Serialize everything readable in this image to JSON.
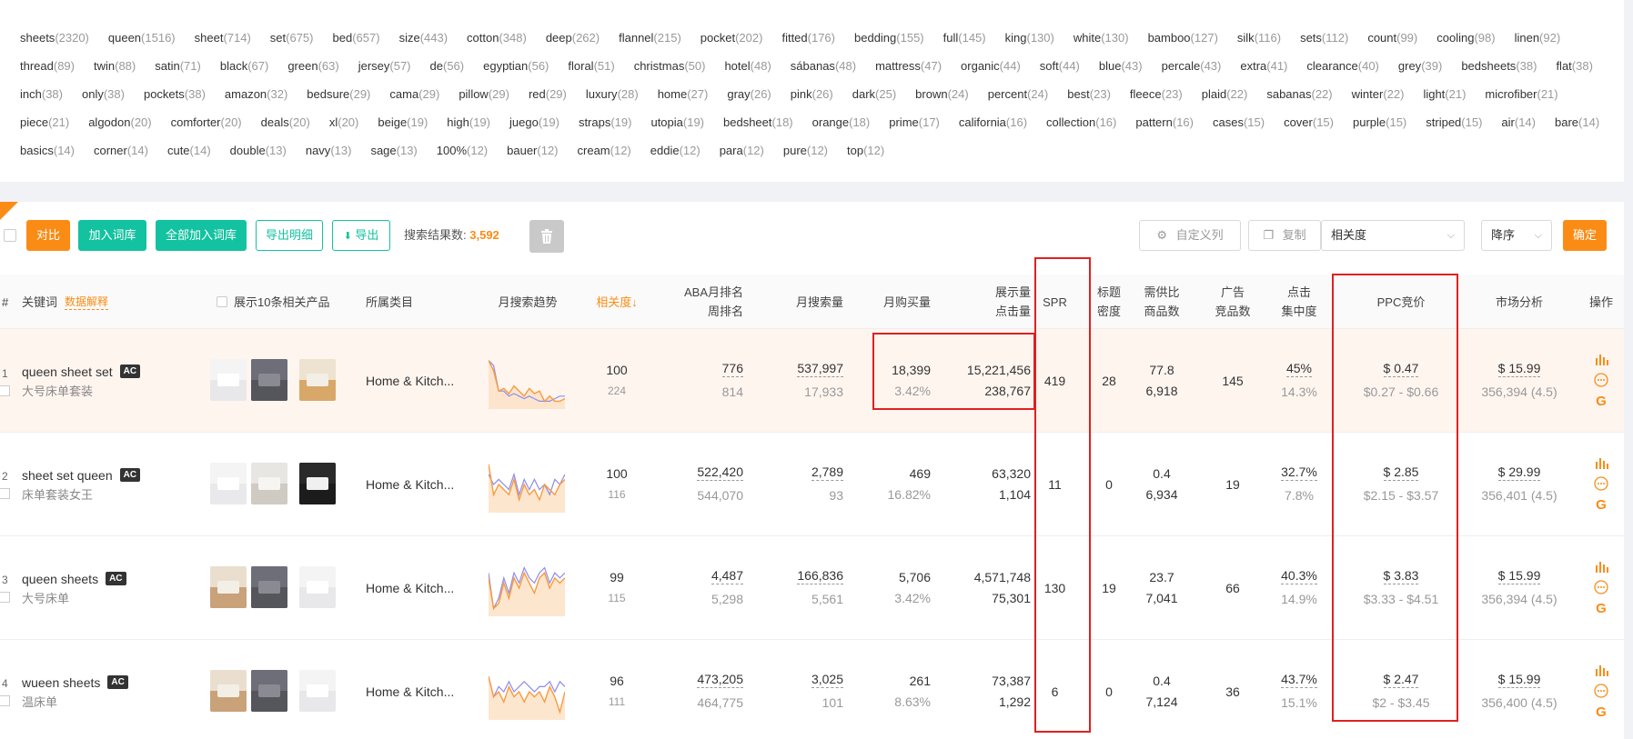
{
  "tags": [
    {
      "word": "sheets",
      "count": "(2320)"
    },
    {
      "word": "queen",
      "count": "(1516)"
    },
    {
      "word": "sheet",
      "count": "(714)"
    },
    {
      "word": "set",
      "count": "(675)"
    },
    {
      "word": "bed",
      "count": "(657)"
    },
    {
      "word": "size",
      "count": "(443)"
    },
    {
      "word": "cotton",
      "count": "(348)"
    },
    {
      "word": "deep",
      "count": "(262)"
    },
    {
      "word": "flannel",
      "count": "(215)"
    },
    {
      "word": "pocket",
      "count": "(202)"
    },
    {
      "word": "fitted",
      "count": "(176)"
    },
    {
      "word": "bedding",
      "count": "(155)"
    },
    {
      "word": "full",
      "count": "(145)"
    },
    {
      "word": "king",
      "count": "(130)"
    },
    {
      "word": "white",
      "count": "(130)"
    },
    {
      "word": "bamboo",
      "count": "(127)"
    },
    {
      "word": "silk",
      "count": "(116)"
    },
    {
      "word": "sets",
      "count": "(112)"
    },
    {
      "word": "count",
      "count": "(99)"
    },
    {
      "word": "cooling",
      "count": "(98)"
    },
    {
      "word": "linen",
      "count": "(92)"
    },
    {
      "word": "thread",
      "count": "(89)"
    },
    {
      "word": "twin",
      "count": "(88)"
    },
    {
      "word": "satin",
      "count": "(71)"
    },
    {
      "word": "black",
      "count": "(67)"
    },
    {
      "word": "green",
      "count": "(63)"
    },
    {
      "word": "jersey",
      "count": "(57)"
    },
    {
      "word": "de",
      "count": "(56)"
    },
    {
      "word": "egyptian",
      "count": "(56)"
    },
    {
      "word": "floral",
      "count": "(51)"
    },
    {
      "word": "christmas",
      "count": "(50)"
    },
    {
      "word": "hotel",
      "count": "(48)"
    },
    {
      "word": "sábanas",
      "count": "(48)"
    },
    {
      "word": "mattress",
      "count": "(47)"
    },
    {
      "word": "organic",
      "count": "(44)"
    },
    {
      "word": "soft",
      "count": "(44)"
    },
    {
      "word": "blue",
      "count": "(43)"
    },
    {
      "word": "percale",
      "count": "(43)"
    },
    {
      "word": "extra",
      "count": "(41)"
    },
    {
      "word": "clearance",
      "count": "(40)"
    },
    {
      "word": "grey",
      "count": "(39)"
    },
    {
      "word": "bedsheets",
      "count": "(38)"
    },
    {
      "word": "flat",
      "count": "(38)"
    },
    {
      "word": "inch",
      "count": "(38)"
    },
    {
      "word": "only",
      "count": "(38)"
    },
    {
      "word": "pockets",
      "count": "(38)"
    },
    {
      "word": "amazon",
      "count": "(32)"
    },
    {
      "word": "bedsure",
      "count": "(29)"
    },
    {
      "word": "cama",
      "count": "(29)"
    },
    {
      "word": "pillow",
      "count": "(29)"
    },
    {
      "word": "red",
      "count": "(29)"
    },
    {
      "word": "luxury",
      "count": "(28)"
    },
    {
      "word": "home",
      "count": "(27)"
    },
    {
      "word": "gray",
      "count": "(26)"
    },
    {
      "word": "pink",
      "count": "(26)"
    },
    {
      "word": "dark",
      "count": "(25)"
    },
    {
      "word": "brown",
      "count": "(24)"
    },
    {
      "word": "percent",
      "count": "(24)"
    },
    {
      "word": "best",
      "count": "(23)"
    },
    {
      "word": "fleece",
      "count": "(23)"
    },
    {
      "word": "plaid",
      "count": "(22)"
    },
    {
      "word": "sabanas",
      "count": "(22)"
    },
    {
      "word": "winter",
      "count": "(22)"
    },
    {
      "word": "light",
      "count": "(21)"
    },
    {
      "word": "microfiber",
      "count": "(21)"
    },
    {
      "word": "piece",
      "count": "(21)"
    },
    {
      "word": "algodon",
      "count": "(20)"
    },
    {
      "word": "comforter",
      "count": "(20)"
    },
    {
      "word": "deals",
      "count": "(20)"
    },
    {
      "word": "xl",
      "count": "(20)"
    },
    {
      "word": "beige",
      "count": "(19)"
    },
    {
      "word": "high",
      "count": "(19)"
    },
    {
      "word": "juego",
      "count": "(19)"
    },
    {
      "word": "straps",
      "count": "(19)"
    },
    {
      "word": "utopia",
      "count": "(19)"
    },
    {
      "word": "bedsheet",
      "count": "(18)"
    },
    {
      "word": "orange",
      "count": "(18)"
    },
    {
      "word": "prime",
      "count": "(17)"
    },
    {
      "word": "california",
      "count": "(16)"
    },
    {
      "word": "collection",
      "count": "(16)"
    },
    {
      "word": "pattern",
      "count": "(16)"
    },
    {
      "word": "cases",
      "count": "(15)"
    },
    {
      "word": "cover",
      "count": "(15)"
    },
    {
      "word": "purple",
      "count": "(15)"
    },
    {
      "word": "striped",
      "count": "(15)"
    },
    {
      "word": "air",
      "count": "(14)"
    },
    {
      "word": "bare",
      "count": "(14)"
    },
    {
      "word": "basics",
      "count": "(14)"
    },
    {
      "word": "corner",
      "count": "(14)"
    },
    {
      "word": "cute",
      "count": "(14)"
    },
    {
      "word": "double",
      "count": "(13)"
    },
    {
      "word": "navy",
      "count": "(13)"
    },
    {
      "word": "sage",
      "count": "(13)"
    },
    {
      "word": "100%",
      "count": "(12)"
    },
    {
      "word": "bauer",
      "count": "(12)"
    },
    {
      "word": "cream",
      "count": "(12)"
    },
    {
      "word": "eddie",
      "count": "(12)"
    },
    {
      "word": "para",
      "count": "(12)"
    },
    {
      "word": "pure",
      "count": "(12)"
    },
    {
      "word": "top",
      "count": "(12)"
    }
  ],
  "toolbar": {
    "compare": "对比",
    "add_to_lib": "加入词库",
    "add_all_to_lib": "全部加入词库",
    "export_detail": "导出明细",
    "export": "导出",
    "result_label": "搜索结果数:",
    "result_count": "3,592",
    "custom_columns": "自定义列",
    "copy": "复制",
    "sort_field": "相关度",
    "sort_order": "降序",
    "confirm": "确定"
  },
  "headers": {
    "num": "#",
    "keyword": "关键词",
    "data_explain": "数据解释",
    "show_products": "展示10条相关产品",
    "category": "所属类目",
    "trend": "月搜索趋势",
    "relevance": "相关度↓",
    "aba_rank_1": "ABA月排名",
    "aba_rank_2": "周排名",
    "monthly_search": "月搜索量",
    "monthly_purchase": "月购买量",
    "impressions_1": "展示量",
    "impressions_2": "点击量",
    "spr": "SPR",
    "title_density_1": "标题",
    "title_density_2": "密度",
    "supply_1": "需供比",
    "supply_2": "商品数",
    "ad_1": "广告",
    "ad_2": "竞品数",
    "click_1": "点击",
    "click_2": "集中度",
    "ppc": "PPC竞价",
    "market": "市场分析",
    "ops": "操作"
  },
  "rows": [
    {
      "num": "1",
      "keyword": "queen sheet set",
      "cn": "大号床单套装",
      "ac": "AC",
      "category": "Home & Kitch...",
      "rel": "100",
      "rel_sub": "224",
      "aba": "776",
      "aba_week": "814",
      "search": "537,997",
      "search_sub": "17,933",
      "purchase": "18,399",
      "purchase_rate": "3.42%",
      "impressions": "15,221,456",
      "clicks": "238,767",
      "spr": "419",
      "title_density": "28",
      "supply_ratio": "77.8",
      "products": "6,918",
      "ad_count": "145",
      "click_conc": "45%",
      "click_conc_sub": "14.3%",
      "ppc": "$ 0.47",
      "ppc_range": "$0.27 - $0.66",
      "market_price": "$ 15.99",
      "market_sub": "356,394 (4.5)"
    },
    {
      "num": "2",
      "keyword": "sheet set queen",
      "cn": "床单套装女王",
      "ac": "AC",
      "category": "Home & Kitch...",
      "rel": "100",
      "rel_sub": "116",
      "aba": "522,420",
      "aba_week": "544,070",
      "search": "2,789",
      "search_sub": "93",
      "purchase": "469",
      "purchase_rate": "16.82%",
      "impressions": "63,320",
      "clicks": "1,104",
      "spr": "11",
      "title_density": "0",
      "supply_ratio": "0.4",
      "products": "6,934",
      "ad_count": "19",
      "click_conc": "32.7%",
      "click_conc_sub": "7.8%",
      "ppc": "$ 2.85",
      "ppc_range": "$2.15 - $3.57",
      "market_price": "$ 29.99",
      "market_sub": "356,401 (4.5)"
    },
    {
      "num": "3",
      "keyword": "queen sheets",
      "cn": "大号床单",
      "ac": "AC",
      "category": "Home & Kitch...",
      "rel": "99",
      "rel_sub": "115",
      "aba": "4,487",
      "aba_week": "5,298",
      "search": "166,836",
      "search_sub": "5,561",
      "purchase": "5,706",
      "purchase_rate": "3.42%",
      "impressions": "4,571,748",
      "clicks": "75,301",
      "spr": "130",
      "title_density": "19",
      "supply_ratio": "23.7",
      "products": "7,041",
      "ad_count": "66",
      "click_conc": "40.3%",
      "click_conc_sub": "14.9%",
      "ppc": "$ 3.83",
      "ppc_range": "$3.33 - $4.51",
      "market_price": "$ 15.99",
      "market_sub": "356,394 (4.5)"
    },
    {
      "num": "4",
      "keyword": "wueen sheets",
      "cn": "温床单",
      "ac": "AC",
      "category": "Home & Kitch...",
      "rel": "96",
      "rel_sub": "111",
      "aba": "473,205",
      "aba_week": "464,775",
      "search": "3,025",
      "search_sub": "101",
      "purchase": "261",
      "purchase_rate": "8.63%",
      "impressions": "73,387",
      "clicks": "1,292",
      "spr": "6",
      "title_density": "0",
      "supply_ratio": "0.4",
      "products": "7,124",
      "ad_count": "36",
      "click_conc": "43.7%",
      "click_conc_sub": "15.1%",
      "ppc": "$ 2.47",
      "ppc_range": "$2 - $3.45",
      "market_price": "$ 15.99",
      "market_sub": "356,400 (4.5)"
    }
  ],
  "colors": {
    "accent": "#fa8c16",
    "green": "#13c2a0",
    "highlight": "#e02020",
    "spark_orange": "#fa9a3c",
    "spark_blue": "#8c8cf0"
  }
}
